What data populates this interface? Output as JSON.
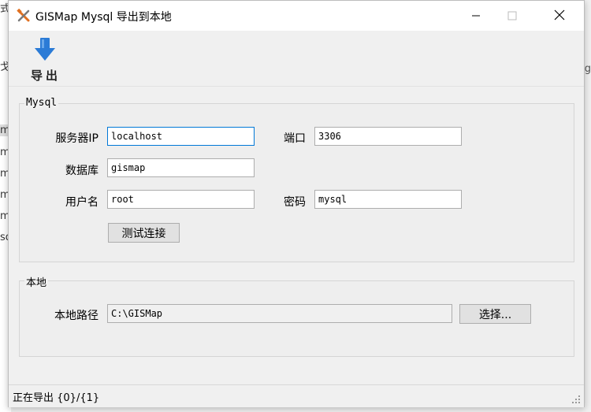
{
  "background": {
    "left_chars": [
      "式",
      "戈",
      "m",
      "m",
      "m",
      "m",
      "m",
      "sq"
    ],
    "right_chars": [
      "ıg",
      "g"
    ]
  },
  "window": {
    "title": "GISMap Mysql 导出到本地",
    "app_icon": "tools-icon",
    "controls": {
      "minimize": "minimize-icon",
      "maximize": "maximize-icon",
      "close": "close-icon"
    }
  },
  "toolbar": {
    "export_label": "导出",
    "export_icon": "download-arrow-icon",
    "accent": "#2b7bd6"
  },
  "mysql": {
    "legend": "Mysql",
    "server_label": "服务器IP",
    "server_value": "localhost",
    "port_label": "端口",
    "port_value": "3306",
    "db_label": "数据库",
    "db_value": "gismap",
    "user_label": "用户名",
    "user_value": "root",
    "password_label": "密码",
    "password_value": "mysql",
    "test_button": "测试连接"
  },
  "local": {
    "legend": "本地",
    "path_label": "本地路径",
    "path_value": "C:\\GISMap",
    "choose_button": "选择..."
  },
  "status": {
    "text": "正在导出 {0}/{1}"
  }
}
